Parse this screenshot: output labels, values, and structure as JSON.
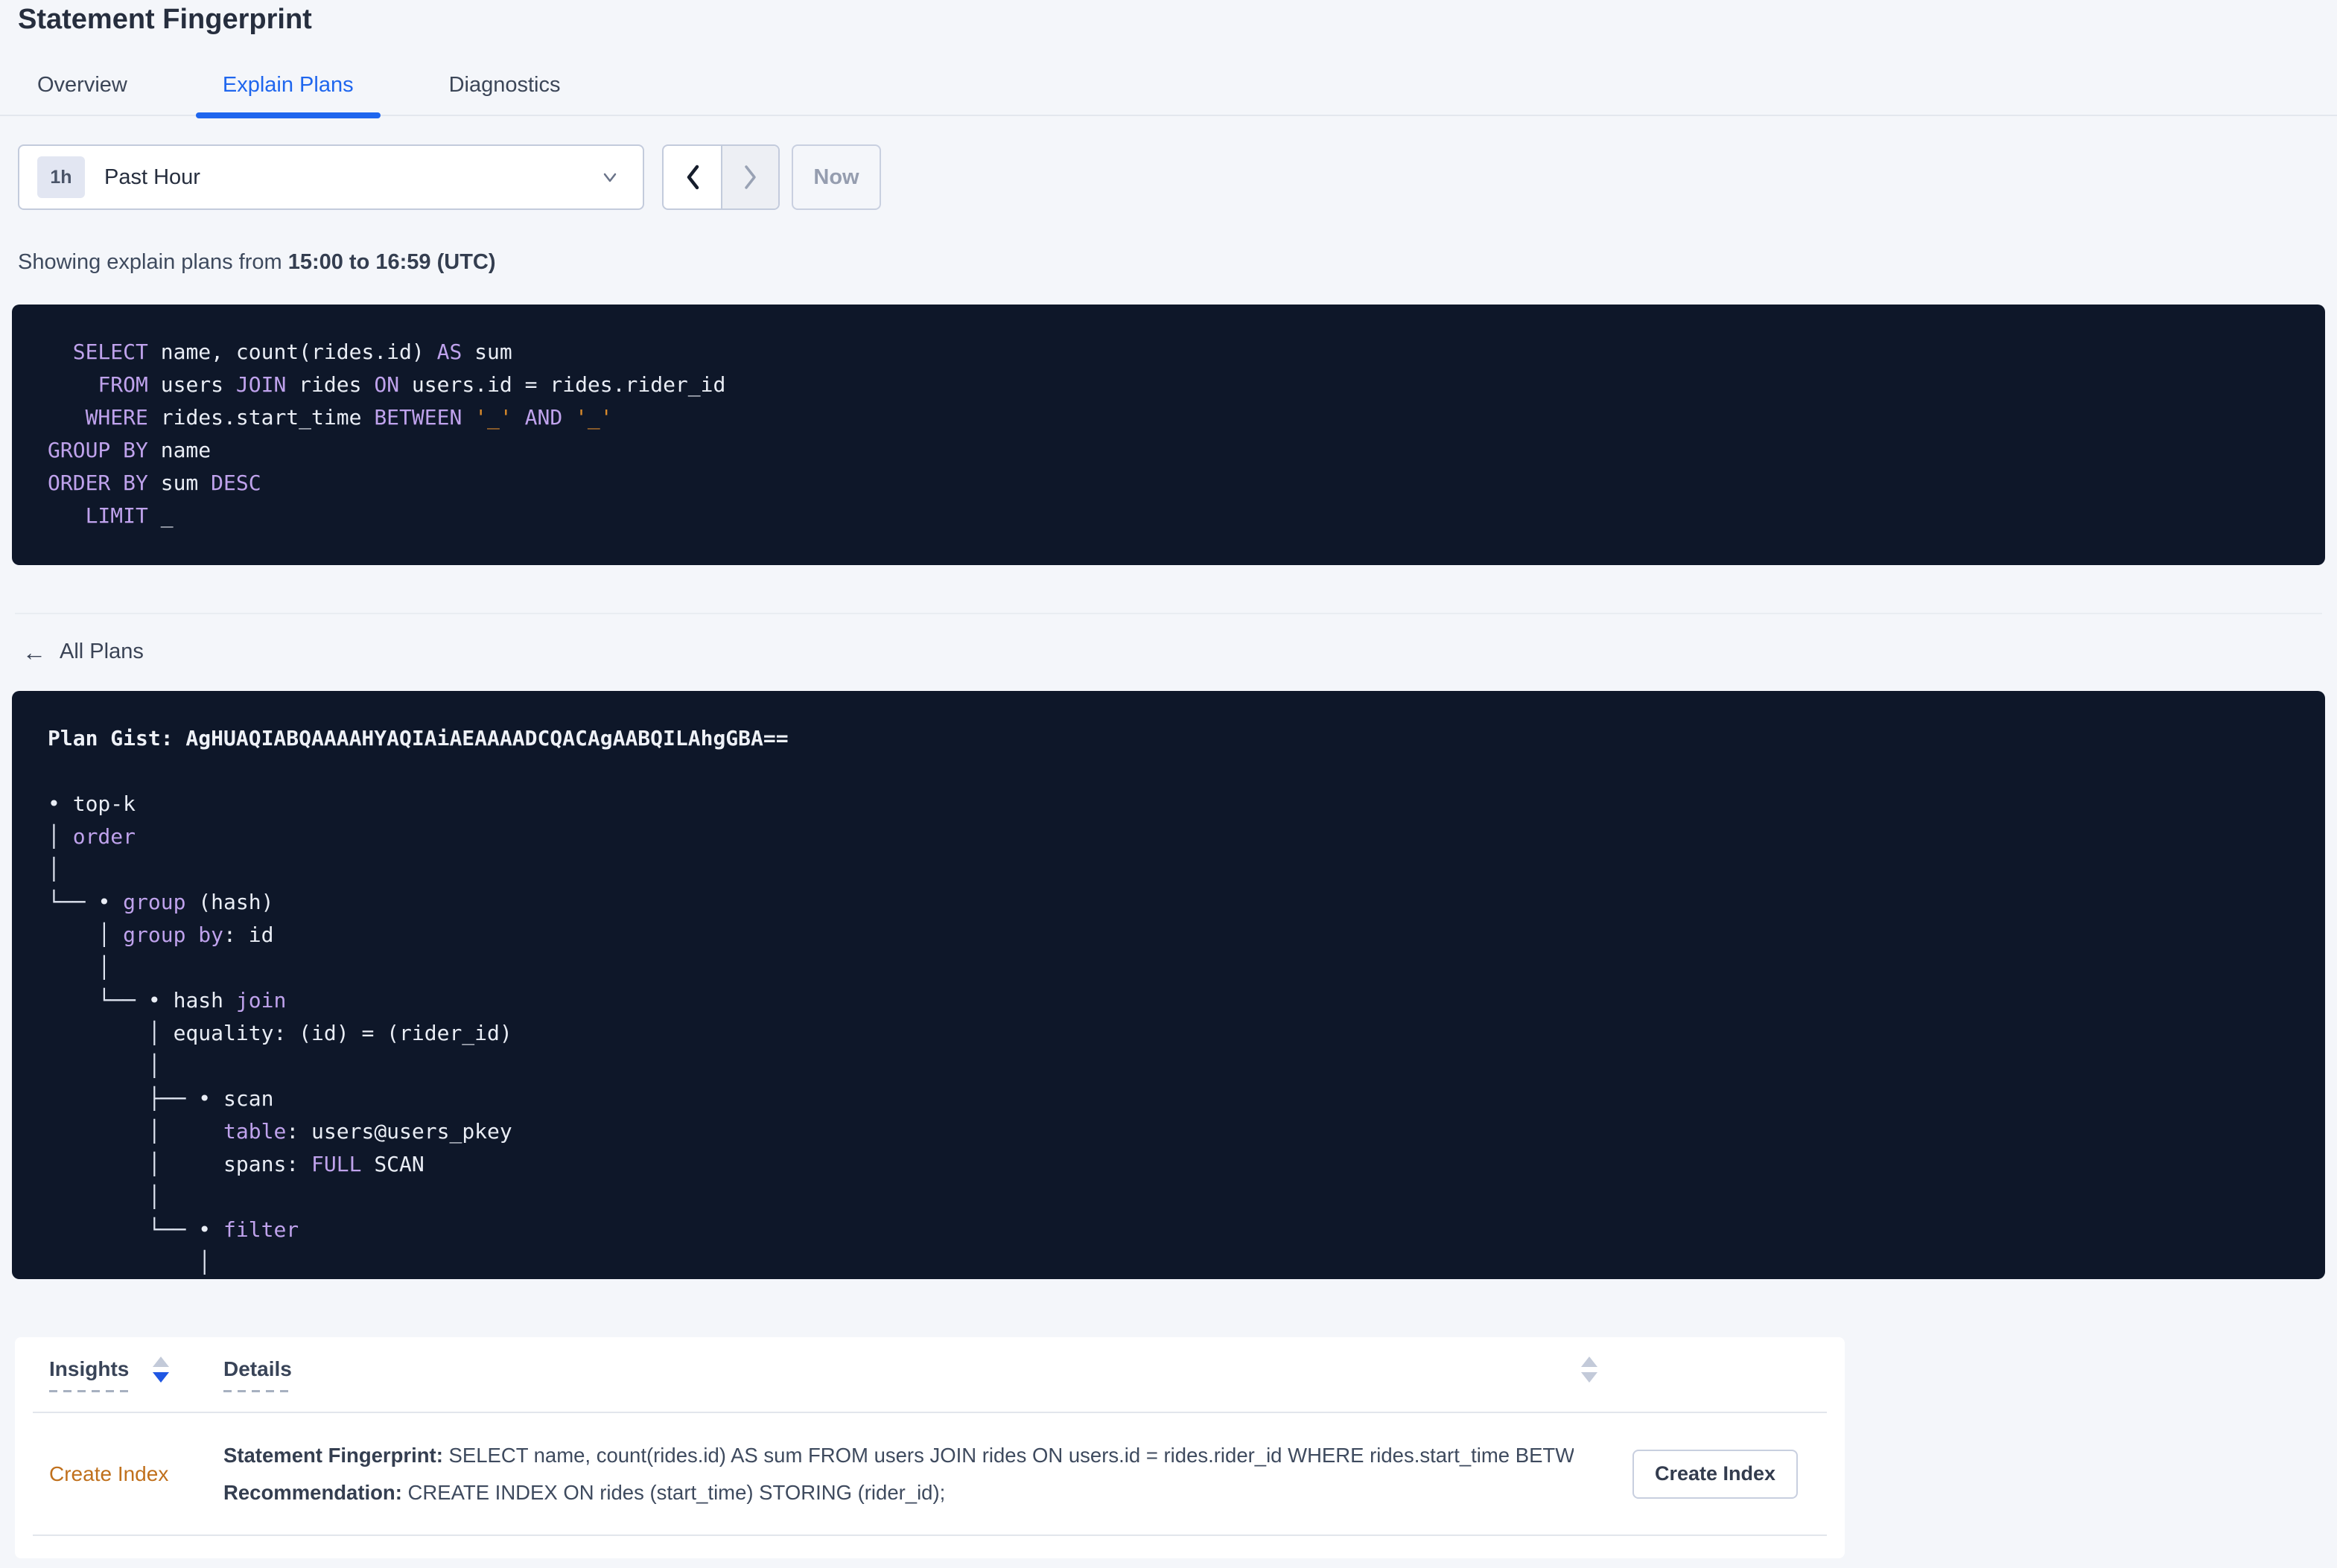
{
  "page_title": "Statement Fingerprint",
  "tabs": {
    "overview": "Overview",
    "explain_plans": "Explain Plans",
    "diagnostics": "Diagnostics",
    "active": "Explain Plans"
  },
  "time_selector": {
    "badge": "1h",
    "label": "Past Hour",
    "now": "Now"
  },
  "showing": {
    "prefix": "Showing explain plans from ",
    "bold": "15:00 to 16:59 (UTC)"
  },
  "sql_block": {
    "lines": [
      [
        [
          "t",
          "  "
        ],
        [
          "k",
          "SELECT"
        ],
        [
          "t",
          " name, count(rides.id) "
        ],
        [
          "k",
          "AS"
        ],
        [
          "t",
          " sum"
        ]
      ],
      [
        [
          "t",
          "    "
        ],
        [
          "k",
          "FROM"
        ],
        [
          "t",
          " users "
        ],
        [
          "k",
          "JOIN"
        ],
        [
          "t",
          " rides "
        ],
        [
          "k",
          "ON"
        ],
        [
          "t",
          " users.id = rides.rider_id"
        ]
      ],
      [
        [
          "t",
          "   "
        ],
        [
          "k",
          "WHERE"
        ],
        [
          "t",
          " rides.start_time "
        ],
        [
          "k",
          "BETWEEN"
        ],
        [
          "t",
          " "
        ],
        [
          "o",
          "'_'"
        ],
        [
          "t",
          " "
        ],
        [
          "k",
          "AND"
        ],
        [
          "t",
          " "
        ],
        [
          "o",
          "'_'"
        ]
      ],
      [
        [
          "k",
          "GROUP BY"
        ],
        [
          "t",
          " name"
        ]
      ],
      [
        [
          "k",
          "ORDER BY"
        ],
        [
          "t",
          " sum "
        ],
        [
          "k",
          "DESC"
        ]
      ],
      [
        [
          "t",
          "   "
        ],
        [
          "k",
          "LIMIT"
        ],
        [
          "t",
          " _"
        ]
      ]
    ]
  },
  "back_link": "All Plans",
  "gist_block": {
    "lines": [
      [
        [
          "b",
          "Plan Gist: AgHUAQIABQAAAAHYAQIAiAEAAAADCQACAgAABQILAhgGBA=="
        ]
      ],
      [
        [
          "t",
          ""
        ]
      ],
      [
        [
          "t",
          "• top-k"
        ]
      ],
      [
        [
          "c",
          "│ "
        ],
        [
          "k",
          "order"
        ]
      ],
      [
        [
          "c",
          "│"
        ]
      ],
      [
        [
          "c",
          "└── "
        ],
        [
          "t",
          "• "
        ],
        [
          "k",
          "group"
        ],
        [
          "t",
          " (hash)"
        ]
      ],
      [
        [
          "t",
          "    "
        ],
        [
          "c",
          "│ "
        ],
        [
          "k",
          "group by"
        ],
        [
          "t",
          ": id"
        ]
      ],
      [
        [
          "t",
          "    "
        ],
        [
          "c",
          "│"
        ]
      ],
      [
        [
          "t",
          "    "
        ],
        [
          "c",
          "└── "
        ],
        [
          "t",
          "• hash "
        ],
        [
          "k",
          "join"
        ]
      ],
      [
        [
          "t",
          "        "
        ],
        [
          "c",
          "│ "
        ],
        [
          "t",
          "equality: (id) = (rider_id)"
        ]
      ],
      [
        [
          "t",
          "        "
        ],
        [
          "c",
          "│"
        ]
      ],
      [
        [
          "t",
          "        "
        ],
        [
          "c",
          "├── "
        ],
        [
          "t",
          "• scan"
        ]
      ],
      [
        [
          "t",
          "        "
        ],
        [
          "c",
          "│     "
        ],
        [
          "k",
          "table"
        ],
        [
          "t",
          ": users@users_pkey"
        ]
      ],
      [
        [
          "t",
          "        "
        ],
        [
          "c",
          "│     "
        ],
        [
          "t",
          "spans: "
        ],
        [
          "k",
          "FULL"
        ],
        [
          "t",
          " SCAN"
        ]
      ],
      [
        [
          "t",
          "        "
        ],
        [
          "c",
          "│"
        ]
      ],
      [
        [
          "t",
          "        "
        ],
        [
          "c",
          "└── "
        ],
        [
          "t",
          "• "
        ],
        [
          "k",
          "filter"
        ]
      ],
      [
        [
          "t",
          "            "
        ],
        [
          "c",
          "│"
        ]
      ]
    ]
  },
  "insights": {
    "headers": {
      "insights": "Insights",
      "details": "Details"
    },
    "rows": [
      {
        "insight": "Create Index",
        "fingerprint_label": "Statement Fingerprint:",
        "fingerprint_text": " SELECT name, count(rides.id) AS sum FROM users JOIN rides ON users.id = rides.rider_id WHERE rides.start_time BETWEEN '_…",
        "recommendation_label": "Recommendation:",
        "recommendation_text": " CREATE INDEX ON rides (start_time) STORING (rider_id);",
        "action": "Create Index"
      }
    ]
  },
  "colors": {
    "accent_blue": "#1f66ee",
    "sort_active_blue": "#2057e3",
    "code_background": "#0e1729",
    "code_keyword": "#bfa2ec",
    "code_text": "#e9edf5",
    "code_literal_orange": "#d98a2b",
    "insight_link_orange": "#c0701c",
    "page_background": "#f4f6fa"
  }
}
